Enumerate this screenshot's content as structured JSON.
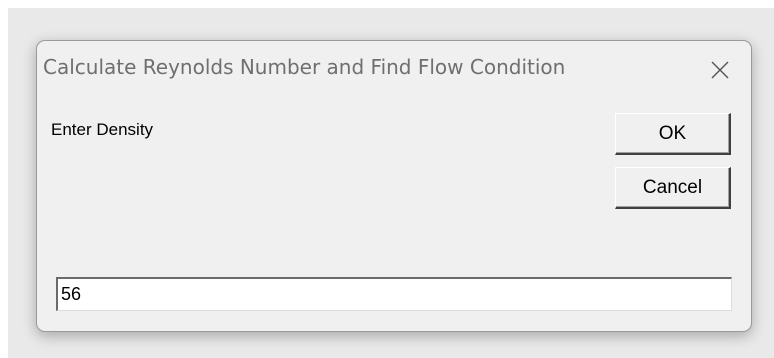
{
  "dialog": {
    "title": "Calculate Reynolds Number and Find Flow Condition",
    "prompt": "Enter Density",
    "ok_label": "OK",
    "cancel_label": "Cancel",
    "input_value": "56",
    "close_icon": "close-icon"
  }
}
